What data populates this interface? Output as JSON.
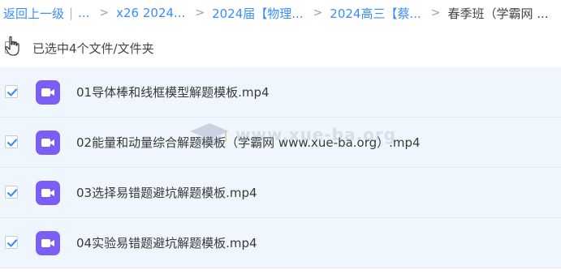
{
  "breadcrumb": {
    "back_label": "返回上一级",
    "sep": "|",
    "ellipsis": "...",
    "items": [
      {
        "label": "x26 2024..."
      },
      {
        "label": "2024届【物理..."
      },
      {
        "label": "2024高三【蔡..."
      }
    ],
    "current": "春季班（学霸网 ..."
  },
  "selection": {
    "text": "已选中4个文件/文件夹"
  },
  "files": [
    {
      "name": "01导体棒和线框模型解题模板.mp4",
      "checked": true
    },
    {
      "name": "02能量和动量综合解题模板（学霸网 www.xue-ba.org）.mp4",
      "checked": true
    },
    {
      "name": "03选择易错题避坑解题模板.mp4",
      "checked": true
    },
    {
      "name": "04实验易错题避坑解题模板.mp4",
      "checked": true
    }
  ],
  "watermark": {
    "text": "www.xue-ba.org"
  },
  "colors": {
    "link": "#3b8cff",
    "video_icon": "#7b5ff5",
    "row_bg": "#f0f6fd",
    "check": "#3b8cff"
  },
  "icons": {
    "cursor": "hand-pointer-icon",
    "file": "video-file-icon",
    "check": "checkmark-icon"
  }
}
